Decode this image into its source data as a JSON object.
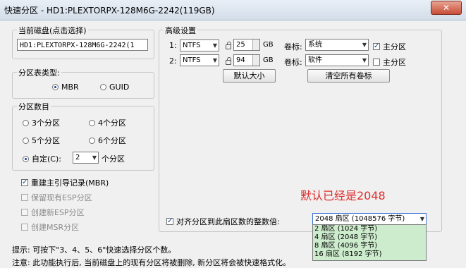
{
  "window": {
    "title": "快速分区 - HD1:PLEXTORPX-128M6G-2242(119GB)",
    "close_glyph": "✕"
  },
  "disk": {
    "group_title": "当前磁盘(点击选择)",
    "value": "HD1:PLEXTORPX-128M6G-2242(1"
  },
  "partition_table": {
    "group_title": "分区表类型:",
    "mbr": "MBR",
    "guid": "GUID"
  },
  "partition_count": {
    "group_title": "分区数目",
    "opt3": "3个分区",
    "opt4": "4个分区",
    "opt5": "5个分区",
    "opt6": "6个分区",
    "custom": "自定(C):",
    "custom_value": "2",
    "custom_suffix": "个分区"
  },
  "options": {
    "rebuild_mbr": "重建主引导记录(MBR)",
    "keep_esp": "保留现有ESP分区",
    "create_esp": "创建新ESP分区",
    "create_msr": "创建MSR分区"
  },
  "advanced": {
    "group_title": "高级设置",
    "rows": [
      {
        "index": "1:",
        "fs": "NTFS",
        "size": "25",
        "unit": "GB",
        "label_caption": "卷标:",
        "label": "系统",
        "primary_label": "主分区",
        "primary_checked": true
      },
      {
        "index": "2:",
        "fs": "NTFS",
        "size": "94",
        "unit": "GB",
        "label_caption": "卷标:",
        "label": "软件",
        "primary_label": "主分区",
        "primary_checked": false
      }
    ],
    "default_size_button": "默认大小",
    "clear_labels_button": "清空所有卷标"
  },
  "annotation": "默认已经是2048",
  "align": {
    "label": "对齐分区到此扇区数的整数倍:",
    "selected": "2048 扇区 (1048576 字节)",
    "options": [
      "2 扇区 (1024 字节)",
      "4 扇区 (2048 字节)",
      "8 扇区 (4096 字节)",
      "16 扇区 (8192 字节)"
    ]
  },
  "tips": {
    "line1": "提示: 可按下\"3、4、5、6\"快速选择分区个数。",
    "line2": "注意: 此功能执行后, 当前磁盘上的现有分区将被删除, 新分区将会被快速格式化。"
  },
  "icons": {
    "lock": "lock-icon",
    "dropdown_arrow": "▼",
    "check_mark": "✓",
    "spin_up": "▲",
    "spin_down": "▼"
  }
}
